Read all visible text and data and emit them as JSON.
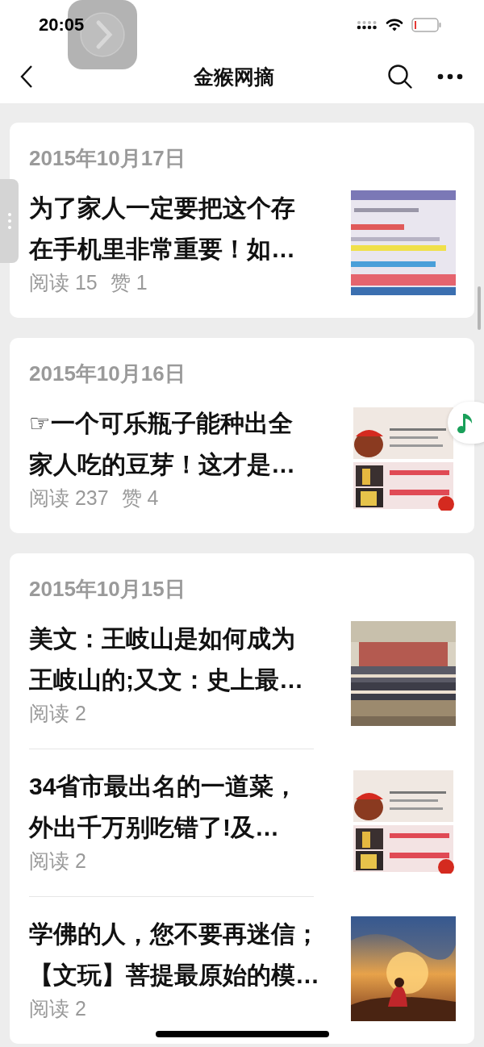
{
  "status_bar": {
    "time": "20:05"
  },
  "nav_bar": {
    "title": "金猴网摘"
  },
  "groups": [
    {
      "date": "2015年10月17日",
      "articles": [
        {
          "title_lines": [
            "为了家人一定要把这个存",
            "在手机里非常重要！如…"
          ],
          "reads": "阅读 15",
          "likes": "赞 1",
          "thumbnail": {
            "kind": "picture"
          }
        }
      ]
    },
    {
      "date": "2015年10月16日",
      "articles": [
        {
          "title_lines": [
            "☞一个可乐瓶子能种出全",
            "家人吃的豆芽！这才是…"
          ],
          "reads": "阅读 237",
          "likes": "赞 4",
          "thumbnail": {
            "kind": "picture"
          }
        }
      ]
    },
    {
      "date": "2015年10月15日",
      "articles": [
        {
          "title_lines": [
            "美文：王岐山是如何成为",
            "王岐山的;又文：史上最…"
          ],
          "reads": "阅读 2",
          "thumbnail": {
            "kind": "picture"
          }
        },
        {
          "title_lines": [
            "34省市最出名的一道菜，",
            "外出千万别吃错了!及…"
          ],
          "reads": "阅读 2",
          "thumbnail": {
            "kind": "picture"
          }
        },
        {
          "title_lines": [
            "学佛的人，您不要再迷信；",
            "【文玩】菩提最原始的模…"
          ],
          "reads": "阅读 2",
          "thumbnail": {
            "kind": "picture"
          }
        }
      ]
    }
  ]
}
